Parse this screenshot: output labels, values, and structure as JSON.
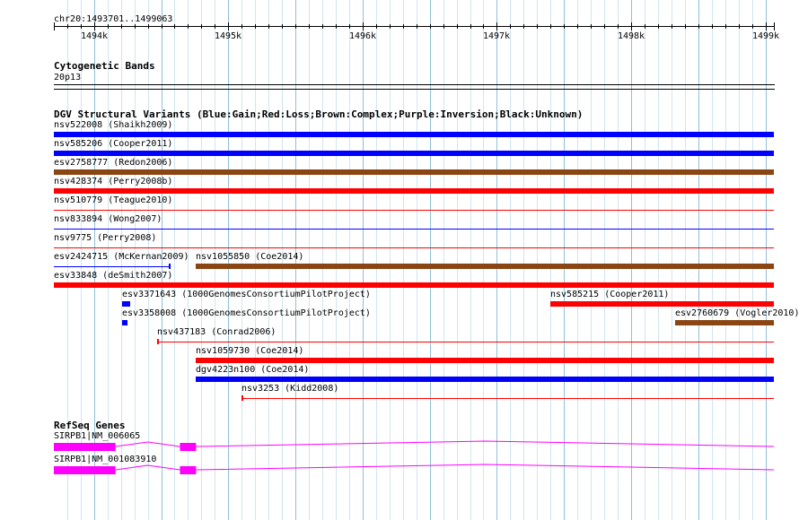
{
  "ruler": {
    "region": "chr20:1493701..1499063",
    "ticks": [
      "1494k",
      "1495k",
      "1496k",
      "1497k",
      "1498k",
      "1499k"
    ]
  },
  "cytoband": {
    "title": "Cytogenetic Bands",
    "band": "20p13"
  },
  "dgv": {
    "title": "DGV Structural Variants (Blue:Gain;Red:Loss;Brown:Complex;Purple:Inversion;Black:Unknown)",
    "colors": {
      "gain": "#0000ff",
      "loss": "#ff0000",
      "complex": "#8b4513",
      "inversion": "#800080",
      "unknown": "#000000"
    },
    "features": [
      {
        "label": "nsv522008 (Shaikh2009)",
        "type": "gain",
        "start": 1493701,
        "end": 1499063,
        "style": "thick"
      },
      {
        "label": "nsv585206 (Cooper2011)",
        "type": "gain",
        "start": 1493701,
        "end": 1499063,
        "style": "thick"
      },
      {
        "label": "esv2758777 (Redon2006)",
        "type": "complex",
        "start": 1493701,
        "end": 1499063,
        "style": "thick"
      },
      {
        "label": "nsv428374 (Perry2008b)",
        "type": "loss",
        "start": 1493701,
        "end": 1499063,
        "style": "thick"
      },
      {
        "label": "nsv510779 (Teague2010)",
        "type": "loss",
        "start": 1493701,
        "end": 1499063,
        "style": "thin"
      },
      {
        "label": "nsv833894 (Wong2007)",
        "type": "gain",
        "start": 1493701,
        "end": 1499063,
        "style": "thin"
      },
      {
        "label": "nsv9775 (Perry2008)",
        "type": "loss",
        "start": 1493701,
        "end": 1499063,
        "style": "thin"
      },
      {
        "label": "esv2424715 (McKernan2009)",
        "type": "gain",
        "start": 1493701,
        "end": 1494560,
        "style": "thin-cap"
      },
      {
        "label": "nsv1055850 (Coe2014)",
        "type": "complex",
        "start": 1494760,
        "end": 1499063,
        "style": "thick"
      },
      {
        "label": "esv33848 (deSmith2007)",
        "type": "loss",
        "start": 1493701,
        "end": 1499063,
        "style": "thick"
      },
      {
        "label": "esv3371643 (1000GenomesConsortiumPilotProject)",
        "type": "gain",
        "start": 1494210,
        "end": 1494270,
        "style": "thick"
      },
      {
        "label": "nsv585215 (Cooper2011)",
        "type": "loss",
        "start": 1497400,
        "end": 1499063,
        "style": "thick"
      },
      {
        "label": "esv3358008 (1000GenomesConsortiumPilotProject)",
        "type": "gain",
        "start": 1494210,
        "end": 1494250,
        "style": "thick"
      },
      {
        "label": "esv2760679 (Vogler2010)",
        "type": "complex",
        "start": 1498330,
        "end": 1499063,
        "style": "thick"
      },
      {
        "label": "nsv437183 (Conrad2006)",
        "type": "loss",
        "start": 1494470,
        "end": 1499063,
        "style": "thin-start"
      },
      {
        "label": "nsv1059730 (Coe2014)",
        "type": "loss",
        "start": 1494760,
        "end": 1499063,
        "style": "thick"
      },
      {
        "label": "dgv4223n100 (Coe2014)",
        "type": "gain",
        "start": 1494760,
        "end": 1499063,
        "style": "thick"
      },
      {
        "label": "nsv3253 (Kidd2008)",
        "type": "loss",
        "start": 1495100,
        "end": 1499063,
        "style": "thin-start"
      }
    ]
  },
  "refseq": {
    "title": "RefSeq Genes",
    "color": "#ff00ff",
    "genes": [
      {
        "label": "SIRPB1|NM_006065",
        "exons": [
          [
            1493701,
            1494160
          ],
          [
            1494640,
            1494760
          ]
        ]
      },
      {
        "label": "SIRPB1|NM_001083910",
        "exons": [
          [
            1493701,
            1494160
          ],
          [
            1494640,
            1494760
          ]
        ]
      }
    ]
  }
}
